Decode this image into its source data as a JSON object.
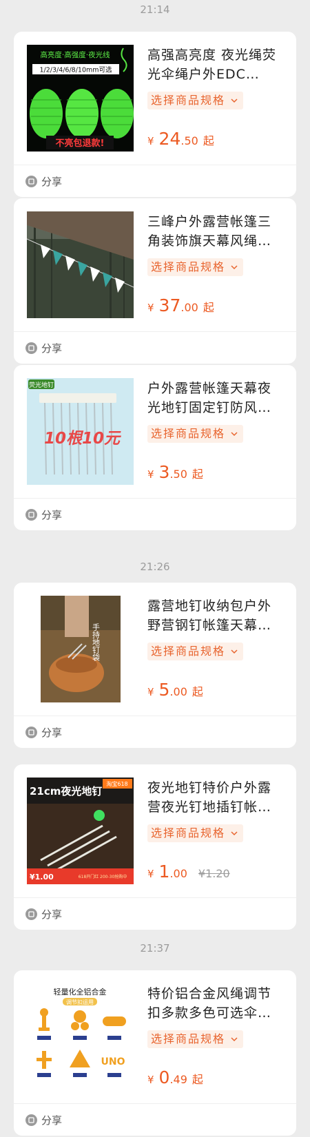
{
  "timestamps": [
    "21:14",
    "21:26",
    "21:37"
  ],
  "spec_label": "选择商品规格",
  "share_label": "分享",
  "currency": "¥",
  "price_suffix": "起",
  "colors": {
    "accent": "#ec5a22",
    "spec_bg": "#fdf0e8",
    "page_bg": "#ececec"
  },
  "products": [
    {
      "title": "高强高亮度 夜光绳荧光伞绳户外EDC…",
      "price_int": "24",
      "price_dec": ".50",
      "thumb_text": [
        "高亮度·高强度·夜光线",
        "1/2/3/4/6/8/10mm可选",
        "不亮包退款!"
      ]
    },
    {
      "title": "三峰户外露营帐篷三角装饰旗天幕风绳…",
      "price_int": "37",
      "price_dec": ".00",
      "thumb_text": []
    },
    {
      "title": "户外露营帐篷天幕夜光地钉固定钉防风…",
      "price_int": "3",
      "price_dec": ".50",
      "thumb_text": [
        "荧光地钉",
        "10根10元"
      ]
    },
    {
      "title": "露营地钉收纳包户外野营钢钉帐篷天幕…",
      "price_int": "5",
      "price_dec": ".00",
      "thumb_text": [
        "手持地钉袋"
      ]
    },
    {
      "title": "夜光地钉特价户外露营夜光钉地插钉帐…",
      "price_int": "1",
      "price_dec": ".00",
      "original_price": "¥1.20",
      "thumb_text": [
        "21cm夜光地钉",
        "淘宝618",
        "¥1.00",
        "618开门红 200-30抢购中"
      ]
    },
    {
      "title": "特价铝合金风绳调节扣多款多色可选伞…",
      "price_int": "0",
      "price_dec": ".49",
      "thumb_text": [
        "轻量化全铝合金",
        "调节扣运用"
      ]
    }
  ]
}
